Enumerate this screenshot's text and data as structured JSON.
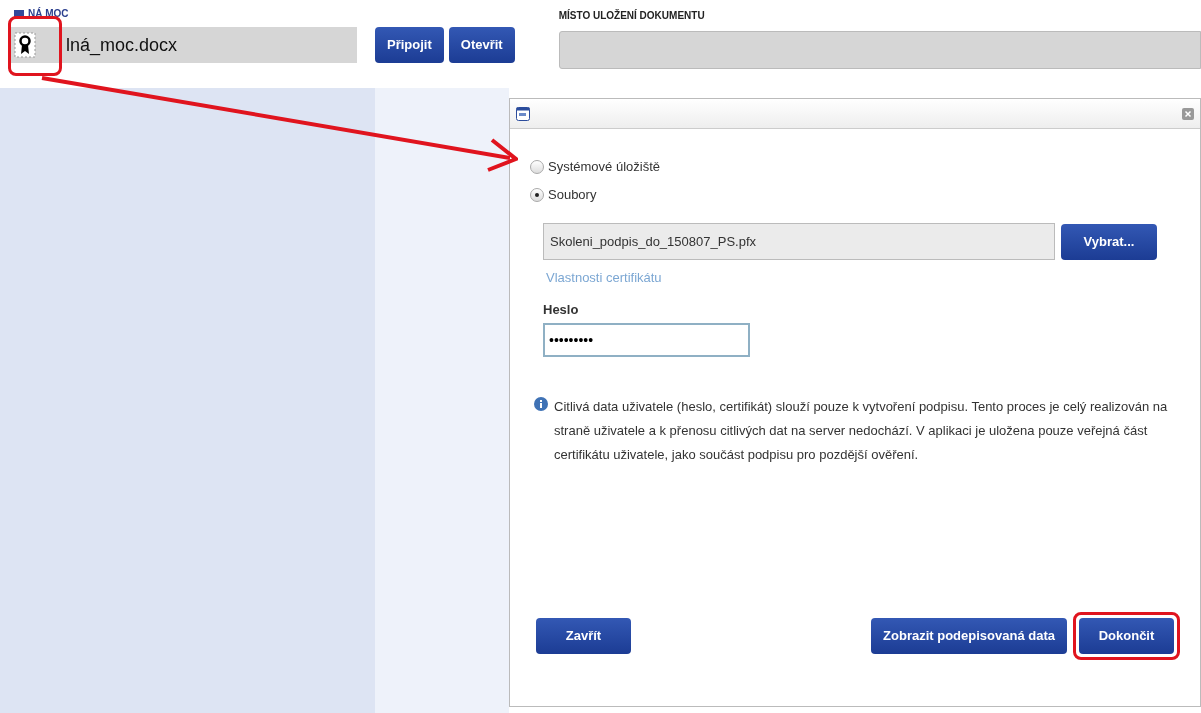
{
  "form": {
    "left_label": "NÁ MOC",
    "file_value": "lná_moc.docx",
    "buttons": [
      "Připojit",
      "Otevřit"
    ],
    "right_label": "MÍSTO ULOŽENÍ DOKUMENTU"
  },
  "dialog": {
    "storage_options": [
      {
        "label": "Systémové úložiště",
        "selected": false
      },
      {
        "label": "Soubory",
        "selected": true
      }
    ],
    "certificate_file": "Skoleni_podpis_do_150807_PS.pfx",
    "choose_button": "Vybrat...",
    "certificate_link": "Vlastnosti certifikátu",
    "password_label": "Heslo",
    "password_value": "•••••••••",
    "info_text": "Citlivá data uživatele (heslo, certifikát) slouží pouze k vytvoření podpisu. Tento proces je celý realizován na straně uživatele a k přenosu citlivých dat na server nedochází. V aplikaci je uložena pouze veřejná část certifikátu uživatele, jako součást podpisu pro pozdější ověření.",
    "buttons": [
      {
        "label": "Zavřít",
        "highlighted": false
      },
      {
        "label": "Zobrazit podepisovaná data",
        "highlighted": false
      },
      {
        "label": "Dokončit",
        "highlighted": true
      }
    ]
  }
}
